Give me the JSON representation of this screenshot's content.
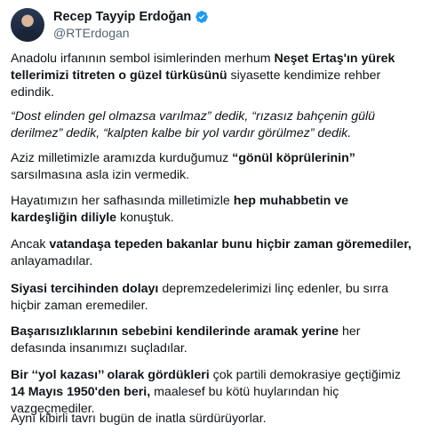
{
  "author": {
    "name": "Recep Tayyip Erdoğan",
    "handle": "@RTErdogan",
    "avatar_icon": "profile-photo",
    "verified_icon": "verified-badge-icon",
    "accent_color": "#1d9bf0"
  },
  "paragraphs": [
    [
      {
        "text": "Anadolu irfanının sembol isimlerinden merhum ",
        "style": "normal"
      },
      {
        "text": "Neşet Ertaş'ın yürek tellerimizi titreten o güzel türküsünü",
        "style": "bold"
      },
      {
        "text": " siyasette kendimize rehber edindik.",
        "style": "normal"
      }
    ],
    [
      {
        "text": "“Dost elinden gel olmazsa varılmaz” dedik, “rızasız bahçenin gülü derilmez” dedik, “kalpten kalbe bir yol vardır görülmez” dedik.",
        "style": "italic"
      }
    ],
    [
      {
        "text": "Aziz milletimizle aramızda kurduğumuz ",
        "style": "normal"
      },
      {
        "text": "“gönül köprülerinin”",
        "style": "bold"
      },
      {
        "text": " sarsılmasına asla izin vermedik.",
        "style": "normal"
      }
    ],
    [
      {
        "text": "Hayatımızın her safhasında milletimizle ",
        "style": "normal"
      },
      {
        "text": "hep muhabbetin ve kardeşliğin diliyle",
        "style": "bold"
      },
      {
        "text": " konuştuk.",
        "style": "normal"
      }
    ],
    [
      {
        "text": "Ancak ",
        "style": "normal"
      },
      {
        "text": "vatandaşa tepeden bakanlar bunu hiçbir zaman göremediler,",
        "style": "bold"
      },
      {
        "text": " anlayamadılar.",
        "style": "normal"
      }
    ],
    [
      {
        "text": "Siyasi tercihinden dolayı",
        "style": "bold"
      },
      {
        "text": " depremzedelerimizi linç edenler, bu sırra hiçbir zaman eremediler.",
        "style": "normal"
      }
    ],
    [
      {
        "text": "Başarısızlıklarının sebebini kendilerinde aramak yerine",
        "style": "bold"
      },
      {
        "text": " her defasında insanımızı suçladılar.",
        "style": "normal"
      }
    ],
    [
      {
        "text": "Bir ‘‘yol kazası’’ olarak gördükleri",
        "style": "bold"
      },
      {
        "text": " çok partili demokrasiye geçtiğimiz ",
        "style": "normal"
      },
      {
        "text": "14 Mayıs 1950'den beri,",
        "style": "bold"
      },
      {
        "text": " maalesef bu kötü huylarından hiç vazgeçmediler.",
        "style": "normal"
      }
    ],
    [
      {
        "text": "Aynı kibirli tavrı bugün de inatla sürdürüyorlar.",
        "style": "normal"
      }
    ]
  ]
}
